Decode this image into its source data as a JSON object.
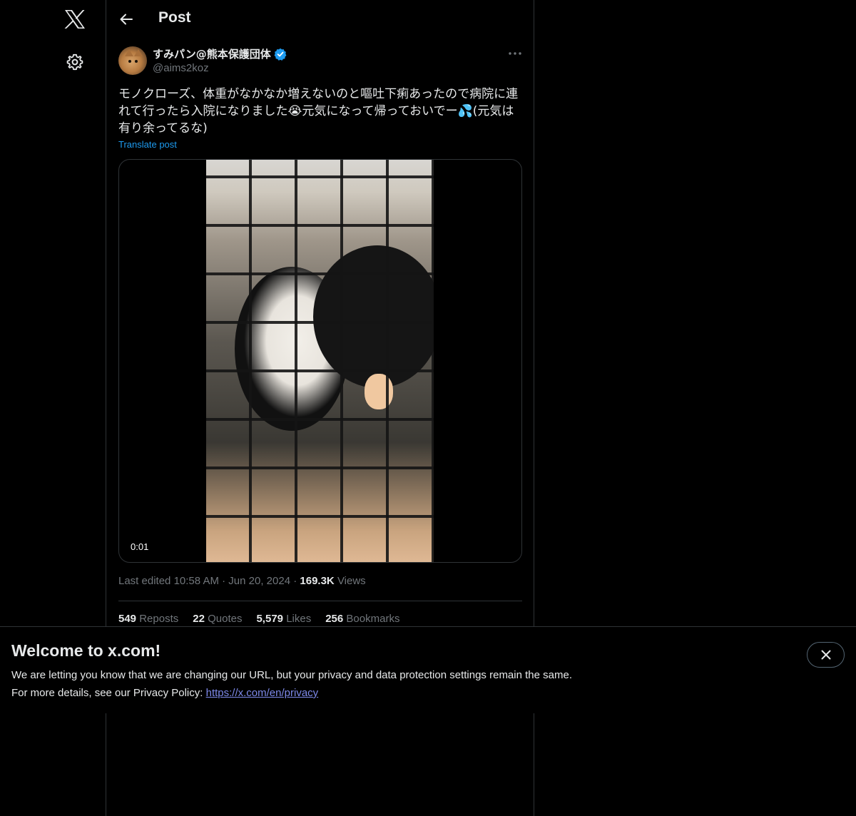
{
  "header": {
    "title": "Post"
  },
  "author": {
    "display_name": "すみパン@熊本保護団体",
    "handle": "@aims2koz"
  },
  "post": {
    "text": "モノクローズ、体重がなかなか増えないのと嘔吐下痢あったので病院に連れて行ったら入院になりました😭元気になって帰っておいでー💦(元気は有り余ってるな)",
    "translate_label": "Translate post",
    "video_timestamp": "0:01"
  },
  "meta": {
    "edited_prefix": "Last edited",
    "time": "10:58 AM",
    "date": "Jun 20, 2024",
    "separator": "·",
    "views_count": "169.3K",
    "views_label": "Views"
  },
  "stats": [
    {
      "count": "549",
      "label": "Reposts"
    },
    {
      "count": "22",
      "label": "Quotes"
    },
    {
      "count": "5,579",
      "label": "Likes"
    },
    {
      "count": "256",
      "label": "Bookmarks"
    }
  ],
  "banner": {
    "title": "Welcome to x.com!",
    "line1": "We are letting you know that we are changing our URL, but your privacy and data protection settings remain the same.",
    "line2_prefix": "For more details, see our Privacy Policy:",
    "link": "https://x.com/en/privacy"
  },
  "colors": {
    "background": "#000000",
    "text": "#e7e9ea",
    "secondary": "#71767b",
    "accent": "#1d9bf0",
    "border": "#2f3336"
  },
  "icons": {
    "logo": "x-logo-icon",
    "settings": "gear-icon",
    "back": "back-arrow-icon",
    "verified": "verified-badge-icon",
    "more": "more-icon",
    "close": "close-icon"
  }
}
